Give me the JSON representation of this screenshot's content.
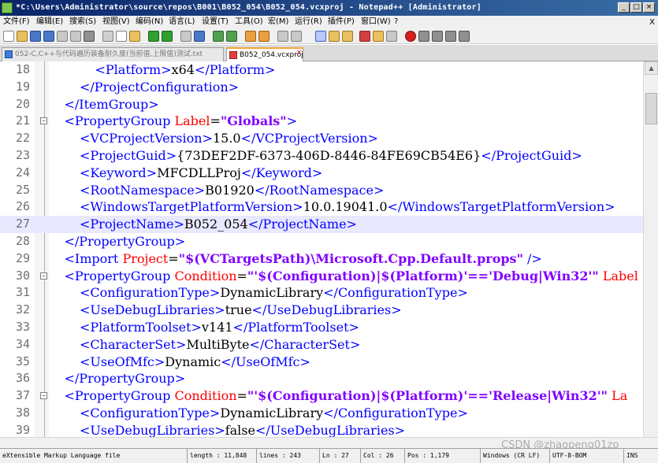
{
  "window": {
    "title": "*C:\\Users\\Administrator\\source\\repos\\B001\\B052_054\\B052_054.vcxproj - Notepad++ [Administrator]",
    "minimize_label": "_",
    "restore_label": "□",
    "close_label": "×"
  },
  "menu": {
    "items": [
      "文件(F)",
      "编辑(E)",
      "搜索(S)",
      "视图(V)",
      "编码(N)",
      "语言(L)",
      "设置(T)",
      "工具(O)",
      "宏(M)",
      "运行(R)",
      "插件(P)",
      "窗口(W)",
      "?"
    ],
    "close_label": "X"
  },
  "tabs": [
    {
      "label": "052-C,C++与代码遍历装备耐久度(当前值,上限值)测试.txt"
    },
    {
      "label": "B052_054.vcxproj"
    }
  ],
  "tab_close_label": "×",
  "editor": {
    "lines": [
      {
        "num": "18",
        "fold": "",
        "current": false,
        "indent": 3,
        "tokens": [
          [
            "lt",
            "<"
          ],
          [
            "tg",
            "Platform"
          ],
          [
            "lt",
            ">"
          ],
          [
            "tx",
            "x64"
          ],
          [
            "lt",
            "</"
          ],
          [
            "tg",
            "Platform"
          ],
          [
            "lt",
            ">"
          ]
        ]
      },
      {
        "num": "19",
        "fold": "",
        "current": false,
        "indent": 2,
        "tokens": [
          [
            "lt",
            "</"
          ],
          [
            "tg",
            "ProjectConfiguration"
          ],
          [
            "lt",
            ">"
          ]
        ]
      },
      {
        "num": "20",
        "fold": "",
        "current": false,
        "indent": 1,
        "tokens": [
          [
            "lt",
            "</"
          ],
          [
            "tg",
            "ItemGroup"
          ],
          [
            "lt",
            ">"
          ]
        ]
      },
      {
        "num": "21",
        "fold": "−",
        "current": false,
        "indent": 1,
        "tokens": [
          [
            "lt",
            "<"
          ],
          [
            "tg",
            "PropertyGroup"
          ],
          [
            "tx",
            " "
          ],
          [
            "at",
            "Label"
          ],
          [
            "tx",
            "="
          ],
          [
            "av",
            "\"Globals\""
          ],
          [
            "lt",
            ">"
          ]
        ]
      },
      {
        "num": "22",
        "fold": "",
        "current": false,
        "indent": 2,
        "tokens": [
          [
            "lt",
            "<"
          ],
          [
            "tg",
            "VCProjectVersion"
          ],
          [
            "lt",
            ">"
          ],
          [
            "tx",
            "15.0"
          ],
          [
            "lt",
            "</"
          ],
          [
            "tg",
            "VCProjectVersion"
          ],
          [
            "lt",
            ">"
          ]
        ]
      },
      {
        "num": "23",
        "fold": "",
        "current": false,
        "indent": 2,
        "tokens": [
          [
            "lt",
            "<"
          ],
          [
            "tg",
            "ProjectGuid"
          ],
          [
            "lt",
            ">"
          ],
          [
            "tx",
            "{73DEF2DF-6373-406D-8446-84FE69CB54E6}"
          ],
          [
            "lt",
            "</"
          ],
          [
            "tg",
            "ProjectGuid"
          ],
          [
            "lt",
            ">"
          ]
        ]
      },
      {
        "num": "24",
        "fold": "",
        "current": false,
        "indent": 2,
        "tokens": [
          [
            "lt",
            "<"
          ],
          [
            "tg",
            "Keyword"
          ],
          [
            "lt",
            ">"
          ],
          [
            "tx",
            "MFCDLLProj"
          ],
          [
            "lt",
            "</"
          ],
          [
            "tg",
            "Keyword"
          ],
          [
            "lt",
            ">"
          ]
        ]
      },
      {
        "num": "25",
        "fold": "",
        "current": false,
        "indent": 2,
        "tokens": [
          [
            "lt",
            "<"
          ],
          [
            "tg",
            "RootNamespace"
          ],
          [
            "lt",
            ">"
          ],
          [
            "tx",
            "B01920"
          ],
          [
            "lt",
            "</"
          ],
          [
            "tg",
            "RootNamespace"
          ],
          [
            "lt",
            ">"
          ]
        ]
      },
      {
        "num": "26",
        "fold": "",
        "current": false,
        "indent": 2,
        "tokens": [
          [
            "lt",
            "<"
          ],
          [
            "tg",
            "WindowsTargetPlatformVersion"
          ],
          [
            "lt",
            ">"
          ],
          [
            "tx",
            "10.0.19041.0"
          ],
          [
            "lt",
            "</"
          ],
          [
            "tg",
            "WindowsTargetPlatformVersion"
          ],
          [
            "lt",
            ">"
          ]
        ]
      },
      {
        "num": "27",
        "fold": "",
        "current": true,
        "indent": 2,
        "tokens": [
          [
            "lt",
            "<"
          ],
          [
            "tg",
            "ProjectName"
          ],
          [
            "lt",
            ">"
          ],
          [
            "tx",
            "B052_054"
          ],
          [
            "lt",
            "</"
          ],
          [
            "tg",
            "ProjectName"
          ],
          [
            "lt",
            ">"
          ]
        ]
      },
      {
        "num": "28",
        "fold": "",
        "current": false,
        "indent": 1,
        "tokens": [
          [
            "lt",
            "</"
          ],
          [
            "tg",
            "PropertyGroup"
          ],
          [
            "lt",
            ">"
          ]
        ]
      },
      {
        "num": "29",
        "fold": "",
        "current": false,
        "indent": 1,
        "tokens": [
          [
            "lt",
            "<"
          ],
          [
            "tg",
            "Import"
          ],
          [
            "tx",
            " "
          ],
          [
            "at",
            "Project"
          ],
          [
            "tx",
            "="
          ],
          [
            "av",
            "\"$(VCTargetsPath)\\Microsoft.Cpp.Default.props\""
          ],
          [
            "tx",
            " "
          ],
          [
            "lt",
            "/>"
          ]
        ]
      },
      {
        "num": "30",
        "fold": "−",
        "current": false,
        "indent": 1,
        "tokens": [
          [
            "lt",
            "<"
          ],
          [
            "tg",
            "PropertyGroup"
          ],
          [
            "tx",
            " "
          ],
          [
            "at",
            "Condition"
          ],
          [
            "tx",
            "="
          ],
          [
            "av",
            "\"'$(Configuration)|$(Platform)'=='Debug|Win32'\""
          ],
          [
            "tx",
            " "
          ],
          [
            "at",
            "Label"
          ]
        ]
      },
      {
        "num": "31",
        "fold": "",
        "current": false,
        "indent": 2,
        "tokens": [
          [
            "lt",
            "<"
          ],
          [
            "tg",
            "ConfigurationType"
          ],
          [
            "lt",
            ">"
          ],
          [
            "tx",
            "DynamicLibrary"
          ],
          [
            "lt",
            "</"
          ],
          [
            "tg",
            "ConfigurationType"
          ],
          [
            "lt",
            ">"
          ]
        ]
      },
      {
        "num": "32",
        "fold": "",
        "current": false,
        "indent": 2,
        "tokens": [
          [
            "lt",
            "<"
          ],
          [
            "tg",
            "UseDebugLibraries"
          ],
          [
            "lt",
            ">"
          ],
          [
            "tx",
            "true"
          ],
          [
            "lt",
            "</"
          ],
          [
            "tg",
            "UseDebugLibraries"
          ],
          [
            "lt",
            ">"
          ]
        ]
      },
      {
        "num": "33",
        "fold": "",
        "current": false,
        "indent": 2,
        "tokens": [
          [
            "lt",
            "<"
          ],
          [
            "tg",
            "PlatformToolset"
          ],
          [
            "lt",
            ">"
          ],
          [
            "tx",
            "v141"
          ],
          [
            "lt",
            "</"
          ],
          [
            "tg",
            "PlatformToolset"
          ],
          [
            "lt",
            ">"
          ]
        ]
      },
      {
        "num": "34",
        "fold": "",
        "current": false,
        "indent": 2,
        "tokens": [
          [
            "lt",
            "<"
          ],
          [
            "tg",
            "CharacterSet"
          ],
          [
            "lt",
            ">"
          ],
          [
            "tx",
            "MultiByte"
          ],
          [
            "lt",
            "</"
          ],
          [
            "tg",
            "CharacterSet"
          ],
          [
            "lt",
            ">"
          ]
        ]
      },
      {
        "num": "35",
        "fold": "",
        "current": false,
        "indent": 2,
        "tokens": [
          [
            "lt",
            "<"
          ],
          [
            "tg",
            "UseOfMfc"
          ],
          [
            "lt",
            ">"
          ],
          [
            "tx",
            "Dynamic"
          ],
          [
            "lt",
            "</"
          ],
          [
            "tg",
            "UseOfMfc"
          ],
          [
            "lt",
            ">"
          ]
        ]
      },
      {
        "num": "36",
        "fold": "",
        "current": false,
        "indent": 1,
        "tokens": [
          [
            "lt",
            "</"
          ],
          [
            "tg",
            "PropertyGroup"
          ],
          [
            "lt",
            ">"
          ]
        ]
      },
      {
        "num": "37",
        "fold": "−",
        "current": false,
        "indent": 1,
        "tokens": [
          [
            "lt",
            "<"
          ],
          [
            "tg",
            "PropertyGroup"
          ],
          [
            "tx",
            " "
          ],
          [
            "at",
            "Condition"
          ],
          [
            "tx",
            "="
          ],
          [
            "av",
            "\"'$(Configuration)|$(Platform)'=='Release|Win32'\""
          ],
          [
            "tx",
            " "
          ],
          [
            "at",
            "La"
          ]
        ]
      },
      {
        "num": "38",
        "fold": "",
        "current": false,
        "indent": 2,
        "tokens": [
          [
            "lt",
            "<"
          ],
          [
            "tg",
            "ConfigurationType"
          ],
          [
            "lt",
            ">"
          ],
          [
            "tx",
            "DynamicLibrary"
          ],
          [
            "lt",
            "</"
          ],
          [
            "tg",
            "ConfigurationType"
          ],
          [
            "lt",
            ">"
          ]
        ]
      },
      {
        "num": "39",
        "fold": "",
        "current": false,
        "indent": 2,
        "tokens": [
          [
            "lt",
            "<"
          ],
          [
            "tg",
            "UseDebugLibraries"
          ],
          [
            "lt",
            ">"
          ],
          [
            "tx",
            "false"
          ],
          [
            "lt",
            "</"
          ],
          [
            "tg",
            "UseDebugLibraries"
          ],
          [
            "lt",
            ">"
          ]
        ]
      }
    ]
  },
  "watermark": "CSDN @zhaopeng01zp",
  "status": {
    "file_type": "eXtensible Markup Language file",
    "length": "length : 11,848",
    "lines": "lines : 243",
    "ln": "Ln : 27",
    "col": "Col : 26",
    "pos": "Pos : 1,179",
    "eol": "Windows (CR LF)",
    "encoding": "UTF-8-BOM",
    "ins": "INS"
  }
}
